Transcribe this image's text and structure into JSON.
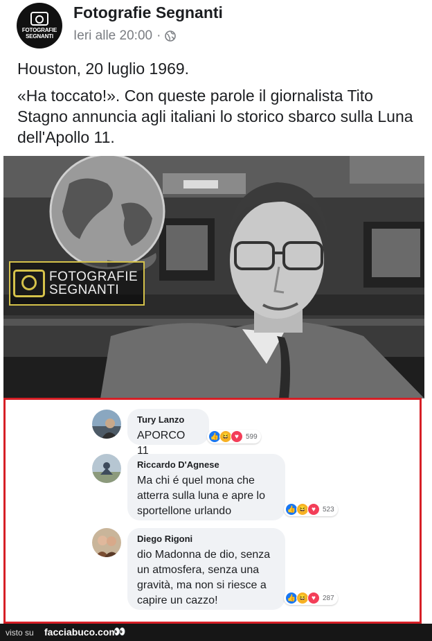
{
  "post": {
    "page_name": "Fotografie Segnanti",
    "avatar_text_1": "FOTOGRAFIE",
    "avatar_text_2": "SEGNANTI",
    "time": "Ieri alle 20:00",
    "separator": "·",
    "privacy_icon": "globe-icon",
    "text_line_1": "Houston, 20 luglio 1969.",
    "text_line_2": "«Ha toccato!». Con queste parole il giornalista Tito Stagno annuncia agli italiani lo storico sbarco sulla Luna dell'Apollo 11."
  },
  "image": {
    "watermark_line_1": "FOTOGRAFIE",
    "watermark_line_2": "SEGNANTI"
  },
  "comments": [
    {
      "author": "Tury Lanzo",
      "text": "APORCO 11",
      "reaction_count": "599"
    },
    {
      "author": "Riccardo D'Agnese",
      "text_lines": [
        "Ma chi é quel mona che",
        "atterra sulla luna e apre lo",
        "sportellone urlando"
      ],
      "reaction_count": "523"
    },
    {
      "author": "Diego Rigoni",
      "text_lines": [
        "dio Madonna de dio, senza",
        "un atmosfera, senza una",
        "gravità, ma non si riesce a",
        "capire un cazzo!"
      ],
      "reaction_count": "287"
    }
  ],
  "footer": {
    "visto_su": "visto su",
    "brand": "facciabuco.com",
    "eyes": "👀"
  },
  "colors": {
    "highlight_border": "#d61f26",
    "like": "#1877f2",
    "haha": "#f7b125",
    "love": "#f33e58"
  }
}
